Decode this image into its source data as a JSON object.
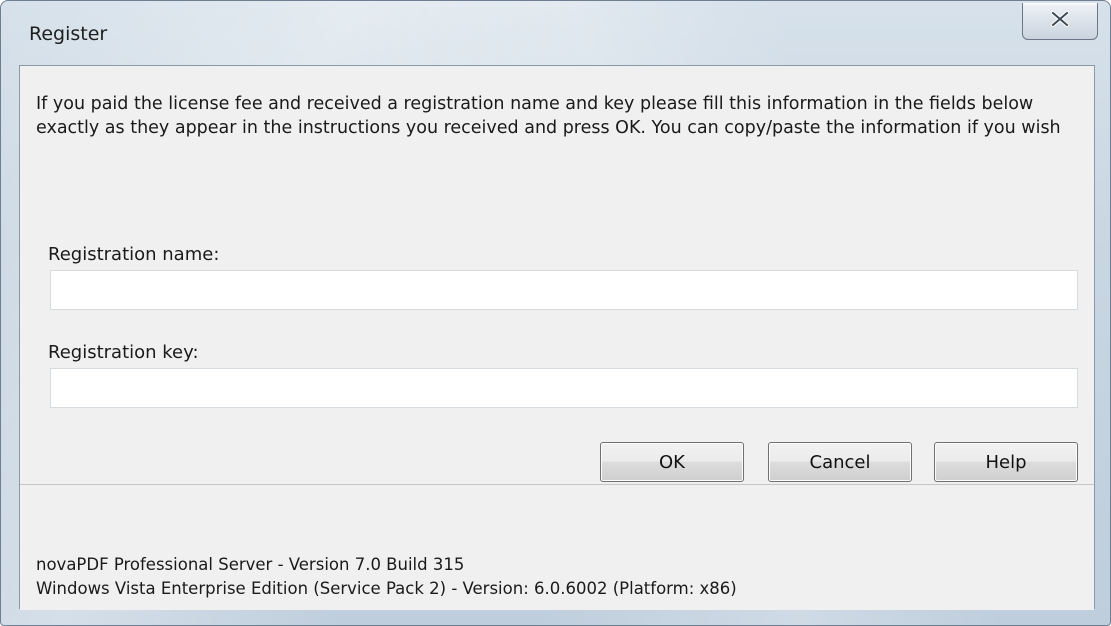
{
  "window": {
    "title": "Register"
  },
  "dialog": {
    "intro_text": "If you paid the license fee and received a registration name and key please fill this information in the fields below exactly as they appear in the instructions you received and press OK. You can copy/paste the information if you wish",
    "registration_name": {
      "label": "Registration name:",
      "value": ""
    },
    "registration_key": {
      "label": "Registration key:",
      "value": ""
    },
    "buttons": {
      "ok": "OK",
      "cancel": "Cancel",
      "help": "Help"
    }
  },
  "footer": {
    "product_line": "novaPDF Professional Server - Version 7.0 Build 315",
    "os_line": "Windows Vista Enterprise Edition (Service Pack 2) - Version: 6.0.6002 (Platform: x86)"
  },
  "icons": {
    "close": "close-icon"
  }
}
